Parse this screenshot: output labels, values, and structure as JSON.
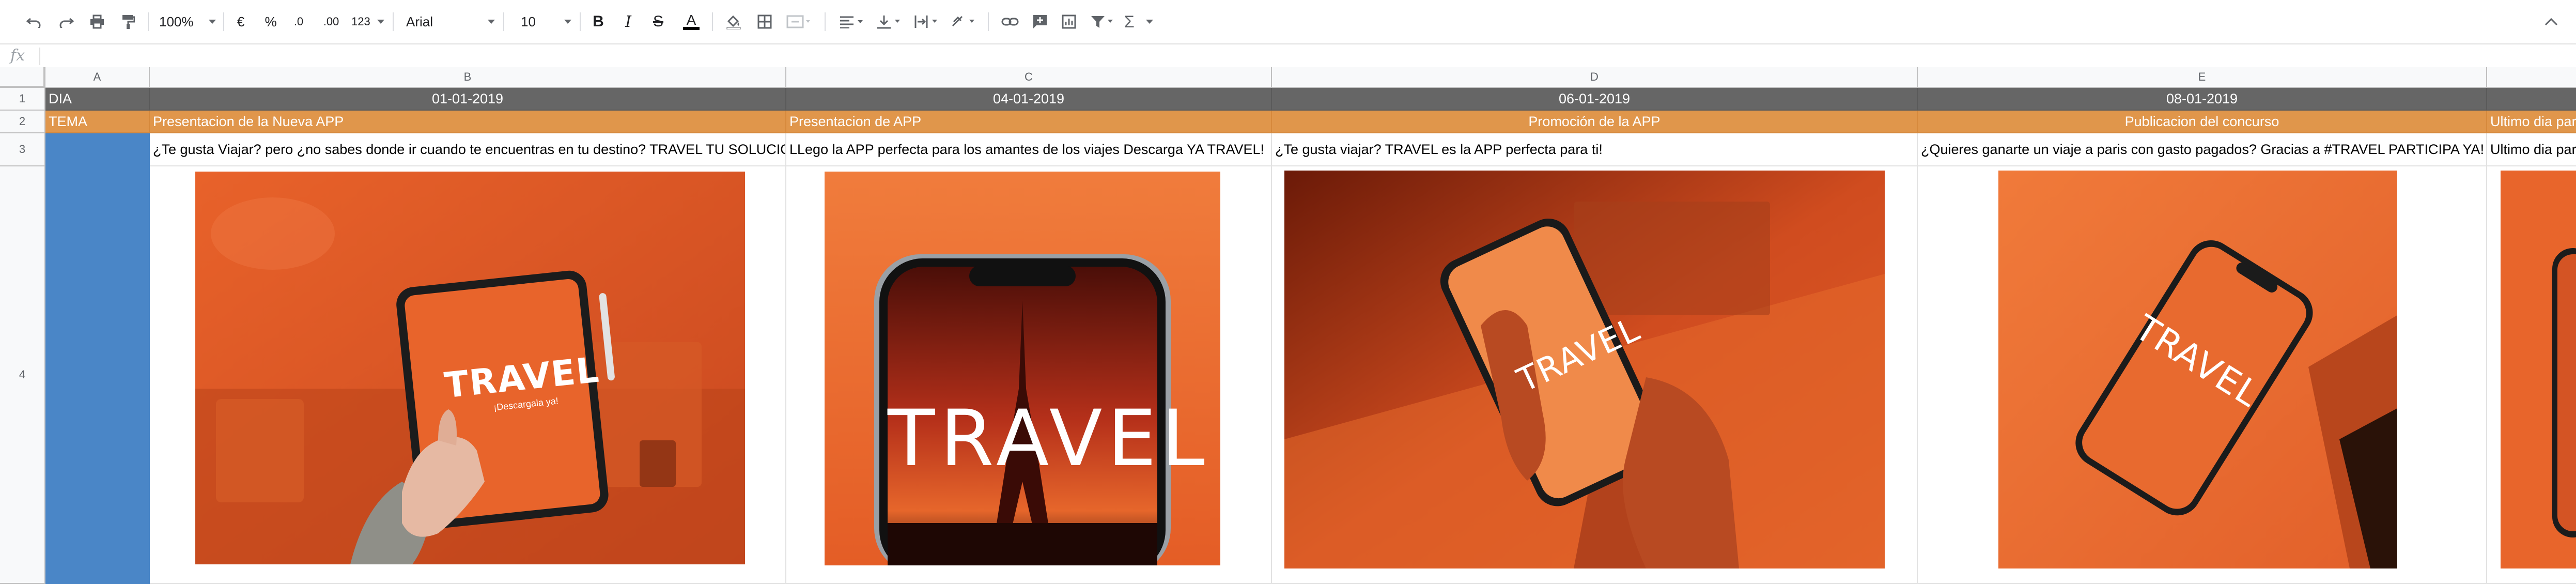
{
  "toolbar": {
    "zoom": "100%",
    "currency": "€",
    "percent": "%",
    "dec_decrease": ".0",
    "dec_increase": ".00",
    "number_format": "123",
    "font": "Arial",
    "font_size": "10",
    "bold": "B",
    "italic": "I",
    "strike": "S",
    "text_color": "A",
    "sum": "Σ"
  },
  "formula_bar": {
    "fx": "fx",
    "value": ""
  },
  "columns": [
    "A",
    "B",
    "C",
    "D",
    "E"
  ],
  "rows": [
    "1",
    "2",
    "3",
    "4"
  ],
  "sheet": {
    "row1": {
      "a": "DIA",
      "b": "01-01-2019",
      "c": "04-01-2019",
      "d": "06-01-2019",
      "e": "08-01-2019"
    },
    "row2": {
      "a": "TEMA",
      "b": "Presentacion de la Nueva APP",
      "c": "Presentacion de APP",
      "d": "Promoción de la APP",
      "e": "Publicacion del concurso",
      "f": "Ultimo dia para"
    },
    "row3": {
      "b": "¿Te gusta Viajar? pero ¿no sabes donde ir cuando te encuentras en tu destino? TRAVEL TU SOLUCION!",
      "c": "LLego la APP perfecta para los amantes de los viajes Descarga YA TRAVEL!",
      "d": "¿Te gusta viajar?  TRAVEL es la APP perfecta para ti!",
      "e": "¿Quieres ganarte un viaje a paris con gasto pagados? Gracias a #TRAVEL PARTICIPA  YA!",
      "f": "Ultimo dia para"
    },
    "row4": {
      "b": {
        "brand": "TRAVEL",
        "tagline": "¡Descargala ya!"
      },
      "c": {
        "brand": "TRAVEL"
      },
      "d": {
        "brand": "TRAVEL"
      },
      "e": {
        "brand": "TRAVEL"
      }
    }
  },
  "colors": {
    "header_gray": "#666666",
    "theme_orange": "#e0964b",
    "blue_fill": "#4a86c7",
    "photo_orange": "#e2632a"
  }
}
